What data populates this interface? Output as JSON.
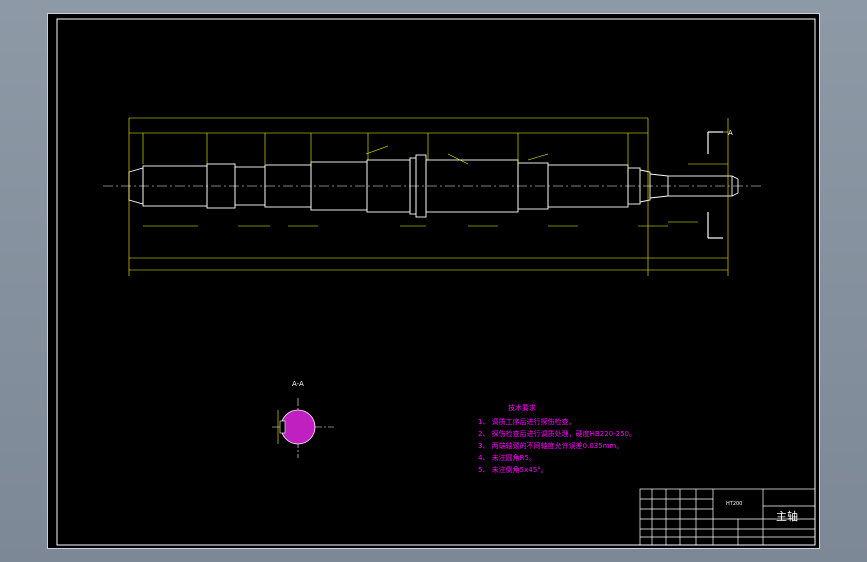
{
  "drawing": {
    "title_block": {
      "part_name": "主轴",
      "scale_note": "1:1",
      "material_code": "HT200",
      "drawing_number": "1:1"
    },
    "technical_requirements": {
      "heading": "技术要求",
      "items": [
        "1、 调质工序后进行探伤检查。",
        "2、 探伤检查后进行调质处理，硬度HB220-250。",
        "3、 两端轴颈的不同轴度允许误差0.035mm。",
        "4、 未注圆角R5。",
        "5、 未注倒角5x45°。"
      ]
    },
    "section_label": "A-A",
    "view_label": "A",
    "colors": {
      "drawing_lines": "#ffffff",
      "dimension_lines": "#ffff00",
      "text_magenta": "#ff00ff",
      "section_fill": "#c020c0",
      "frame": "#ffffff"
    }
  }
}
